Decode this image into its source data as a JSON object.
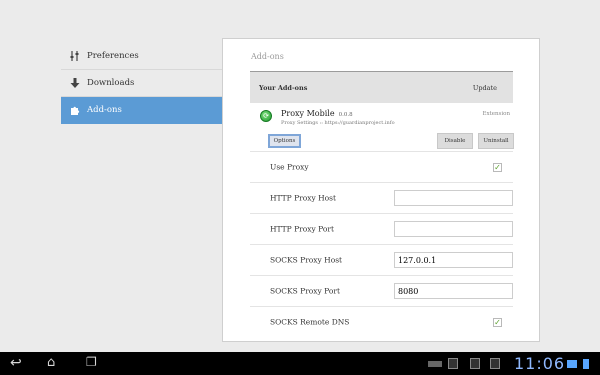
{
  "sidebar": {
    "items": [
      {
        "label": "Preferences",
        "icon": "sliders-icon"
      },
      {
        "label": "Downloads",
        "icon": "download-arrow-icon"
      },
      {
        "label": "Add-ons",
        "icon": "puzzle-piece-icon"
      }
    ]
  },
  "panel": {
    "title": "Add-ons",
    "header": {
      "title": "Your Add-ons",
      "update_label": "Update"
    },
    "addon": {
      "name": "Proxy Mobile",
      "version": "0.0.8",
      "description": "Proxy Settings :: https://guardianproject.info",
      "type": "Extension",
      "options_label": "Options",
      "disable_label": "Disable",
      "uninstall_label": "Uninstall"
    },
    "settings": [
      {
        "label": "Use Proxy",
        "kind": "checkbox",
        "checked": true
      },
      {
        "label": "HTTP Proxy Host",
        "kind": "text",
        "value": ""
      },
      {
        "label": "HTTP Proxy Port",
        "kind": "text",
        "value": ""
      },
      {
        "label": "SOCKS Proxy Host",
        "kind": "text",
        "value": "127.0.0.1"
      },
      {
        "label": "SOCKS Proxy Port",
        "kind": "text",
        "value": "8080"
      },
      {
        "label": "SOCKS Remote DNS",
        "kind": "checkbox",
        "checked": true
      }
    ]
  },
  "taskbar": {
    "clock": "11:06"
  },
  "colors": {
    "accent": "#5b9bd5",
    "clock": "#8fb9ff",
    "check": "#5aa02c"
  }
}
